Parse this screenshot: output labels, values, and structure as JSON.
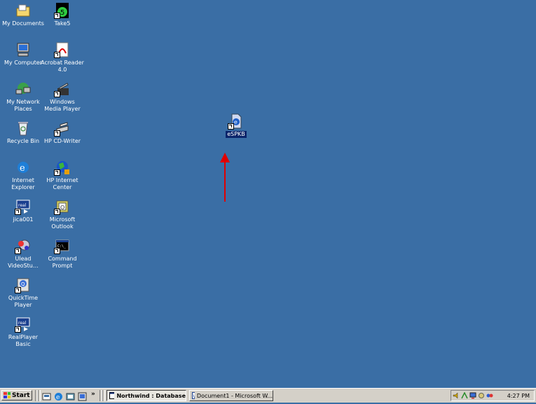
{
  "desktop": {
    "background_color": "#3a6ea5",
    "icons": [
      {
        "label": "My Documents",
        "icon": "folder-icon"
      },
      {
        "label": "Take5",
        "icon": "take5-icon"
      },
      {
        "label": "My Computer",
        "icon": "computer-icon"
      },
      {
        "label": "Acrobat Reader 4.0",
        "icon": "acrobat-icon"
      },
      {
        "label": "My Network Places",
        "icon": "network-icon"
      },
      {
        "label": "Windows Media Player",
        "icon": "media-player-icon"
      },
      {
        "label": "Recycle Bin",
        "icon": "recycle-bin-icon"
      },
      {
        "label": "HP CD-Writer",
        "icon": "cd-writer-icon"
      },
      {
        "label": "Internet Explorer",
        "icon": "ie-icon"
      },
      {
        "label": "HP Internet Center",
        "icon": "globe-icon"
      },
      {
        "label": "jica001",
        "icon": "real-icon"
      },
      {
        "label": "Microsoft Outlook",
        "icon": "outlook-icon"
      },
      {
        "label": "Ulead VideoStu…",
        "icon": "ulead-icon"
      },
      {
        "label": "Command Prompt",
        "icon": "command-prompt-icon"
      },
      {
        "label": "QuickTime Player",
        "icon": "quicktime-icon"
      },
      {
        "label": "RealPlayer Basic",
        "icon": "realplayer-icon"
      }
    ],
    "selected_file": {
      "label": "eSPKB",
      "icon": "ie-document-icon"
    },
    "arrow_color": "#e00000"
  },
  "taskbar": {
    "start_label": "Start",
    "quick_launch_overflow": "»",
    "tasks": [
      {
        "label": "Northwind : Database",
        "active": true
      },
      {
        "label": "Document1 - Microsoft W...",
        "active": false
      }
    ],
    "clock": "4:27 PM"
  }
}
